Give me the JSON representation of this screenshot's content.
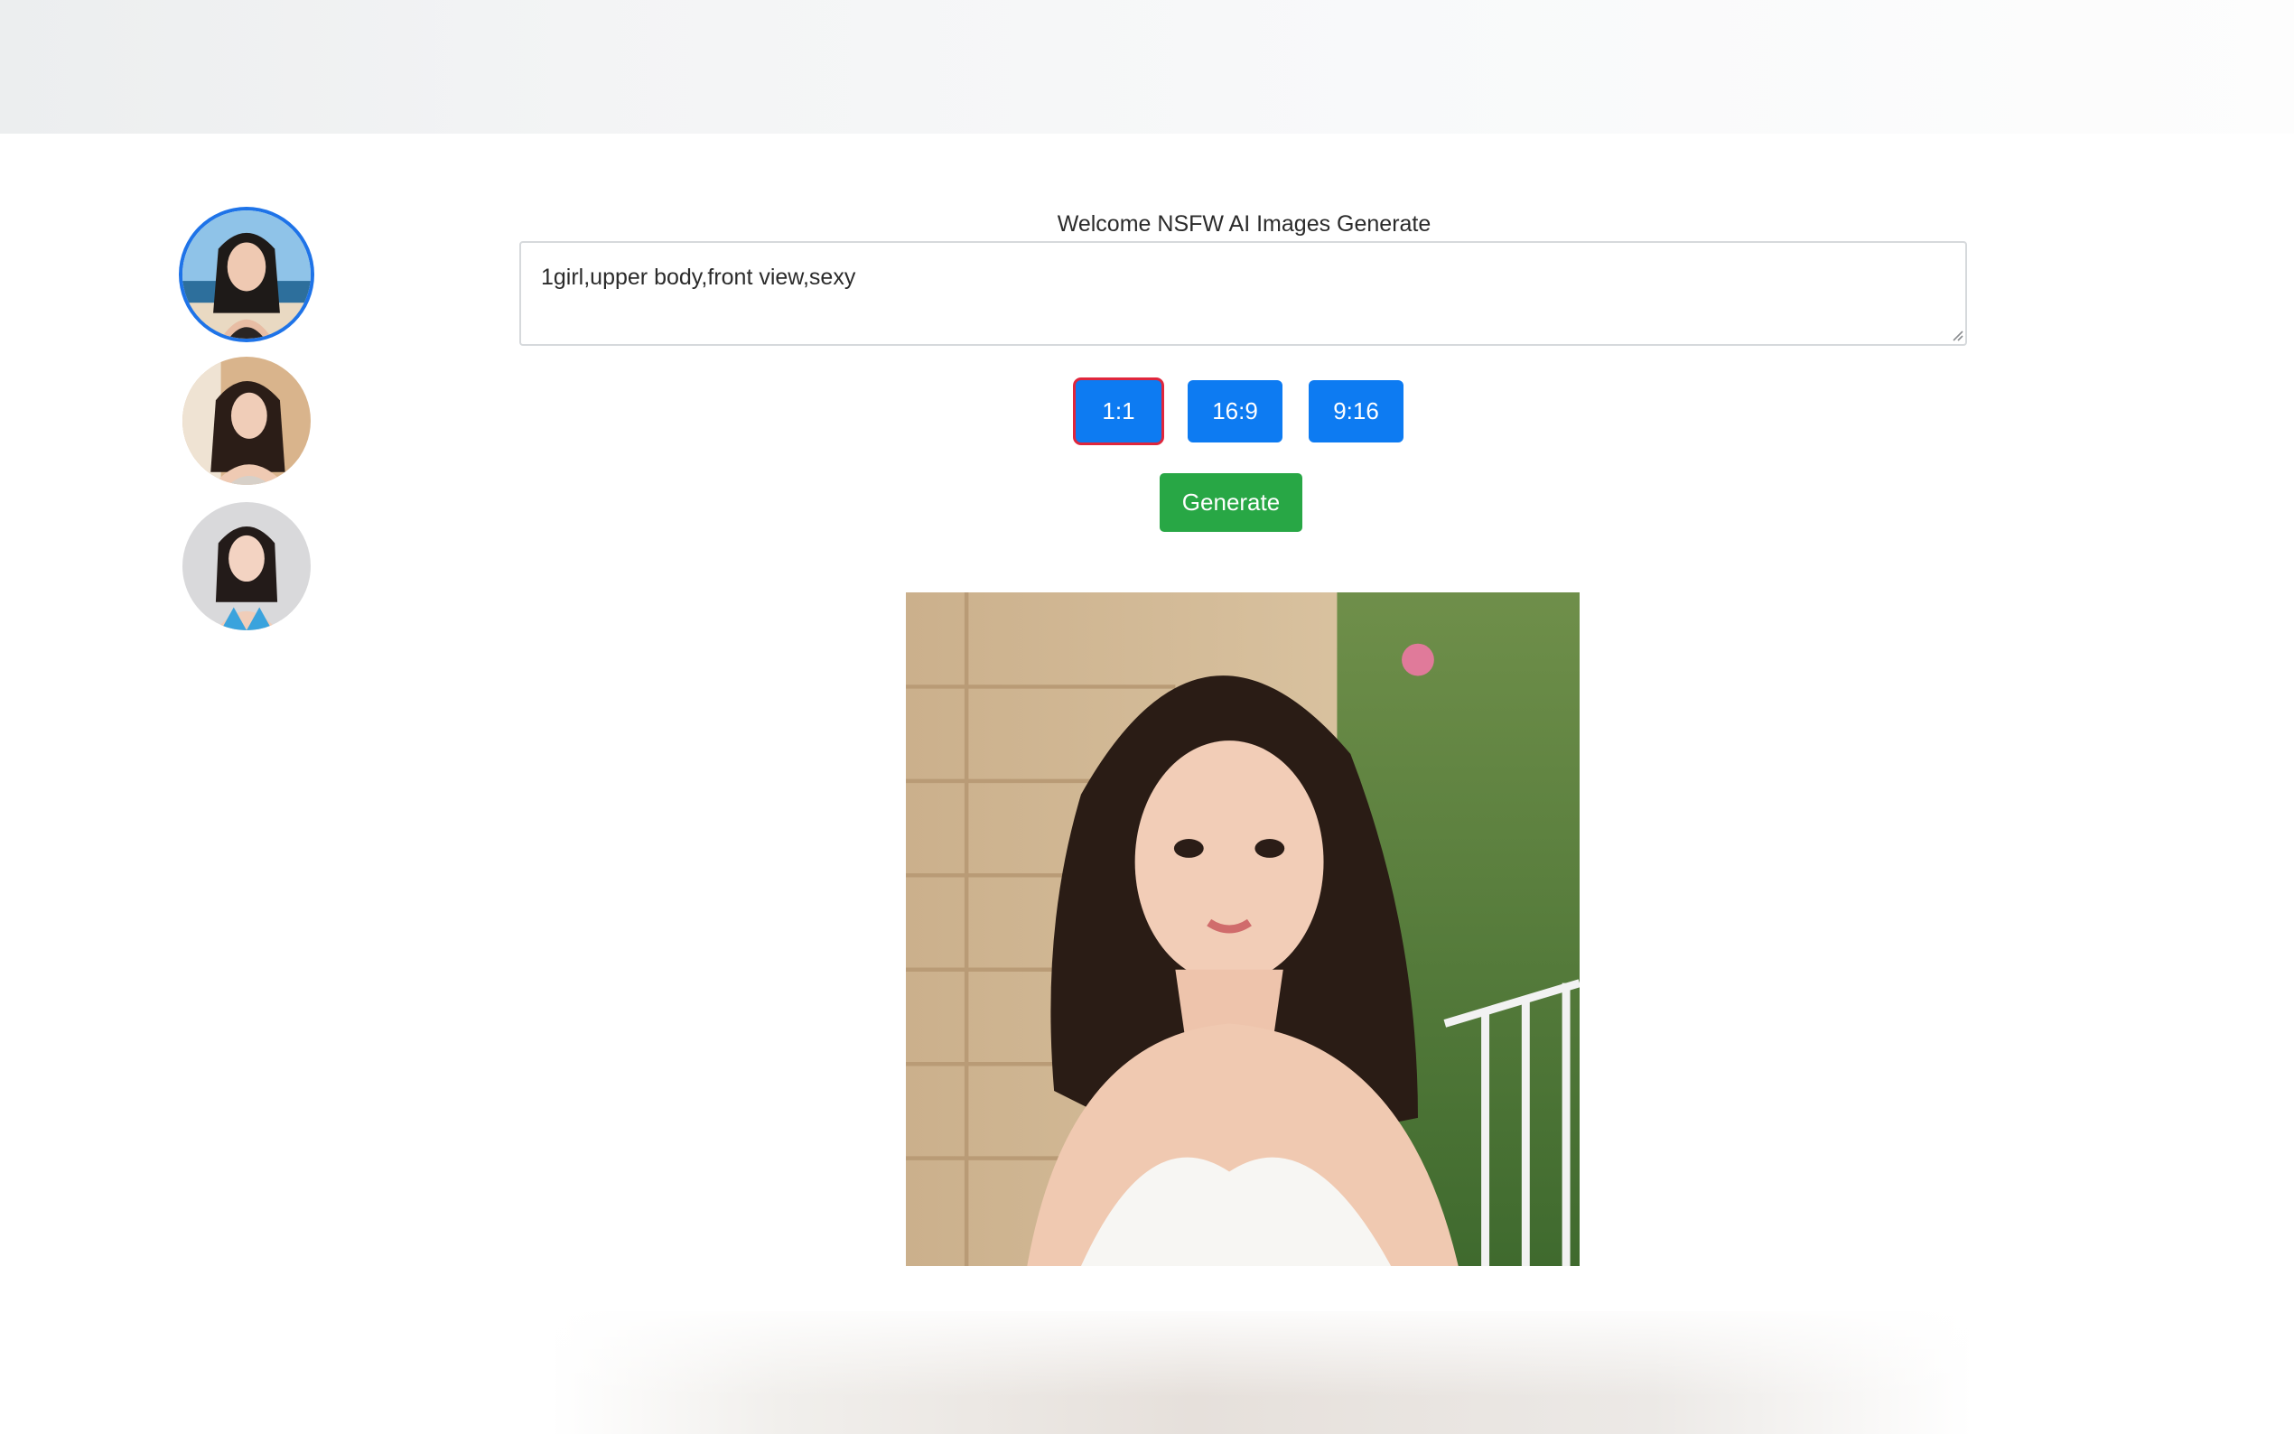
{
  "page": {
    "welcome_text": "Welcome NSFW AI Images Generate"
  },
  "sidebar": {
    "avatars": [
      {
        "name": "avatar-1",
        "selected": true
      },
      {
        "name": "avatar-2",
        "selected": false
      },
      {
        "name": "avatar-3",
        "selected": false
      }
    ]
  },
  "prompt": {
    "value": "1girl,upper body,front view,sexy"
  },
  "aspect_ratios": {
    "options": [
      "1:1",
      "16:9",
      "9:16"
    ],
    "selected": "1:1"
  },
  "actions": {
    "generate_label": "Generate"
  },
  "colors": {
    "primary": "#0d7bf2",
    "success": "#28a745",
    "selected_outline": "#e0263c",
    "avatar_ring": "#1e73e8"
  }
}
